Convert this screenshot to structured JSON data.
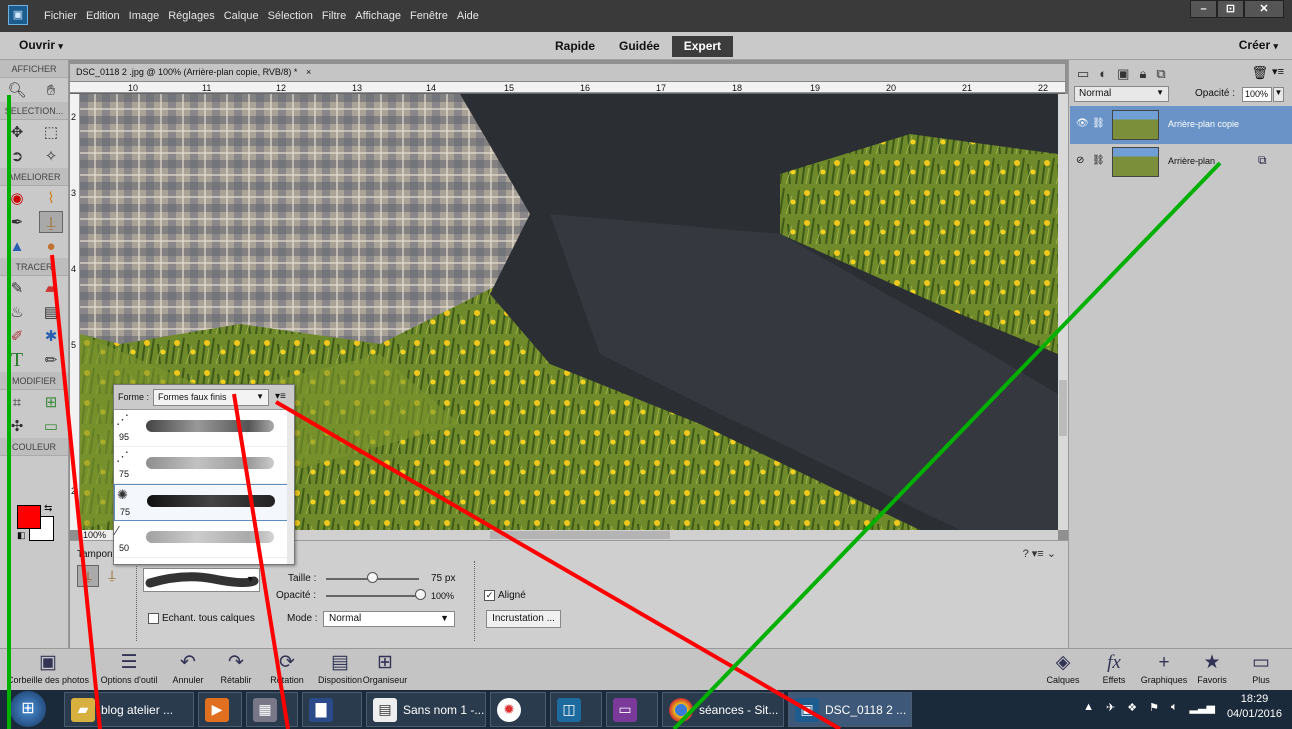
{
  "menubar": {
    "items": [
      "Fichier",
      "Edition",
      "Image",
      "Réglages",
      "Calque",
      "Sélection",
      "Filtre",
      "Affichage",
      "Fenêtre",
      "Aide"
    ],
    "window_controls": [
      "–",
      "⊡",
      "✕"
    ]
  },
  "modebar": {
    "open_label": "Ouvrir",
    "tabs": [
      "Rapide",
      "Guidée",
      "Expert"
    ],
    "active_tab": "Expert",
    "create_label": "Créer"
  },
  "toolbox": {
    "sections": [
      "AFFICHER",
      "SELECTION...",
      "AMELIORER",
      "TRACER",
      "MODIFIER",
      "COULEUR"
    ],
    "foreground_color": "#ff0000",
    "background_color": "#ffffff"
  },
  "document": {
    "tab_title": "DSC_0118 2 .jpg @ 100% (Arrière-plan copie, RVB/8) *",
    "close_glyph": "×",
    "zoom": "100%",
    "ruler_top_labels": [
      "10",
      "11",
      "12",
      "13",
      "14",
      "15",
      "16",
      "17",
      "18",
      "19",
      "20",
      "21",
      "22"
    ],
    "ruler_left_labels": [
      "2",
      "3",
      "4",
      "5",
      "2"
    ]
  },
  "options": {
    "tool_title": "Tampon",
    "size_label": "Taille :",
    "size_value": "75 px",
    "opacity_label": "Opacité :",
    "opacity_value": "100%",
    "aligned_label": "Aligné",
    "sample_all_label": "Echant. tous calques",
    "mode_label": "Mode :",
    "mode_value": "Normal",
    "incrust_button": "Incrustation ..."
  },
  "brush_panel": {
    "form_label": "Forme :",
    "form_value": "Formes faux finis",
    "brushes": [
      {
        "size": "95"
      },
      {
        "size": "75"
      },
      {
        "size": "75",
        "selected": true
      },
      {
        "size": "50"
      }
    ]
  },
  "layers": {
    "blend_mode": "Normal",
    "opacity_label": "Opacité :",
    "opacity_value": "100%",
    "items": [
      {
        "name": "Arrière-plan copie",
        "selected": true
      },
      {
        "name": "Arrière-plan",
        "selected": false
      }
    ]
  },
  "bottom_bar": {
    "left": [
      "Corbeille des photos",
      "Options d'outil",
      "Annuler",
      "Rétablir",
      "Rotation",
      "Disposition",
      "Organiseur"
    ],
    "right": [
      "Calques",
      "Effets",
      "Graphiques",
      "Favoris",
      "Plus"
    ]
  },
  "taskbar": {
    "buttons": [
      "blog atelier ...",
      "Sans nom 1 -...",
      "séances - Sit...",
      "DSC_0118 2 ..."
    ],
    "time": "18:29",
    "date": "04/01/2016"
  },
  "colors": {
    "annotation_red": "#ff0000",
    "annotation_green": "#00b000",
    "layer_selected": "#6a94c8"
  }
}
